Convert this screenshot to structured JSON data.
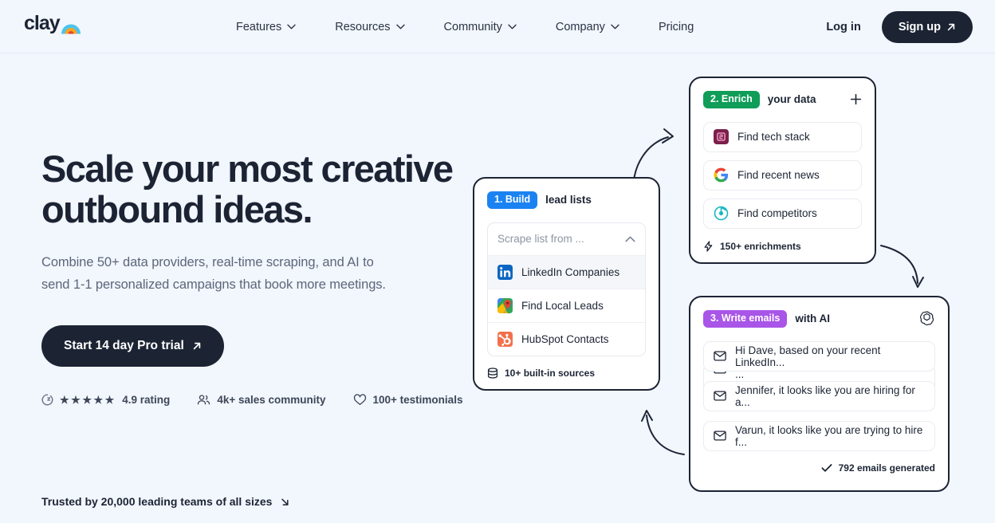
{
  "brand": {
    "name": "clay",
    "logo_icon": "clay-rainbow-logo"
  },
  "nav": {
    "items": [
      {
        "label": "Features",
        "icon": "chevron-down-icon",
        "has_dropdown": true
      },
      {
        "label": "Resources",
        "icon": "chevron-down-icon",
        "has_dropdown": true
      },
      {
        "label": "Community",
        "icon": "chevron-down-icon",
        "has_dropdown": true
      },
      {
        "label": "Company",
        "icon": "chevron-down-icon",
        "has_dropdown": true
      },
      {
        "label": "Pricing",
        "has_dropdown": false
      }
    ],
    "login_label": "Log in",
    "signup_label": "Sign up",
    "signup_icon": "arrow-up-right-icon"
  },
  "hero": {
    "headline_line1": "Scale your most creative",
    "headline_line2": "outbound ideas.",
    "subhead": "Combine 50+ data providers, real-time scraping, and AI to send 1-1 personalized campaigns that book more meetings.",
    "cta_label": "Start 14 day Pro trial",
    "cta_icon": "arrow-up-right-icon",
    "proof": [
      {
        "icon": "g2-logo-icon",
        "stars": 5,
        "label": "4.9 rating"
      },
      {
        "icon": "people-icon",
        "label": "4k+ sales community"
      },
      {
        "icon": "heart-icon",
        "label": "100+ testimonials"
      }
    ]
  },
  "trusted": {
    "label": "Trusted by 20,000 leading teams of all sizes",
    "icon": "arrow-down-right-icon"
  },
  "cards": {
    "build": {
      "badge": "1. Build",
      "badge_color": "#1b82f2",
      "title": "lead lists",
      "dropdown_placeholder": "Scrape list from ...",
      "dropdown_icon": "chevron-up-icon",
      "options": [
        {
          "label": "LinkedIn Companies",
          "icon": "linkedin-icon",
          "selected": true
        },
        {
          "label": "Find Local Leads",
          "icon": "google-maps-icon",
          "selected": false
        },
        {
          "label": "HubSpot Contacts",
          "icon": "hubspot-icon",
          "selected": false
        }
      ],
      "footer_label": "10+ built-in sources",
      "footer_icon": "database-icon"
    },
    "enrich": {
      "badge": "2. Enrich",
      "badge_color": "#0f9d58",
      "title": "your data",
      "add_icon": "plus-icon",
      "rows": [
        {
          "label": "Find tech stack",
          "icon": "builtwith-icon"
        },
        {
          "label": "Find recent news",
          "icon": "google-icon"
        },
        {
          "label": "Find competitors",
          "icon": "similarweb-icon"
        }
      ],
      "footer_label": "150+ enrichments",
      "footer_icon": "lightning-bolt-icon"
    },
    "write": {
      "badge": "3. Write emails",
      "badge_color": "#a855e8",
      "title": "with AI",
      "logo_icon": "openai-icon",
      "rows": [
        {
          "label": "Hi Dave, based on your recent LinkedIn...",
          "icon": "envelope-icon"
        },
        {
          "label": "Jennifer, it looks like you are hiring for a...",
          "icon": "envelope-icon"
        },
        {
          "label": "Varun, it looks like you are trying to hire f...",
          "icon": "envelope-icon"
        }
      ],
      "ghost_row": {
        "label": "Hi Yan, after your recent LinkedIn post ...",
        "icon": "envelope-icon"
      },
      "footer_label": "792 emails generated",
      "footer_icon": "check-icon"
    }
  }
}
